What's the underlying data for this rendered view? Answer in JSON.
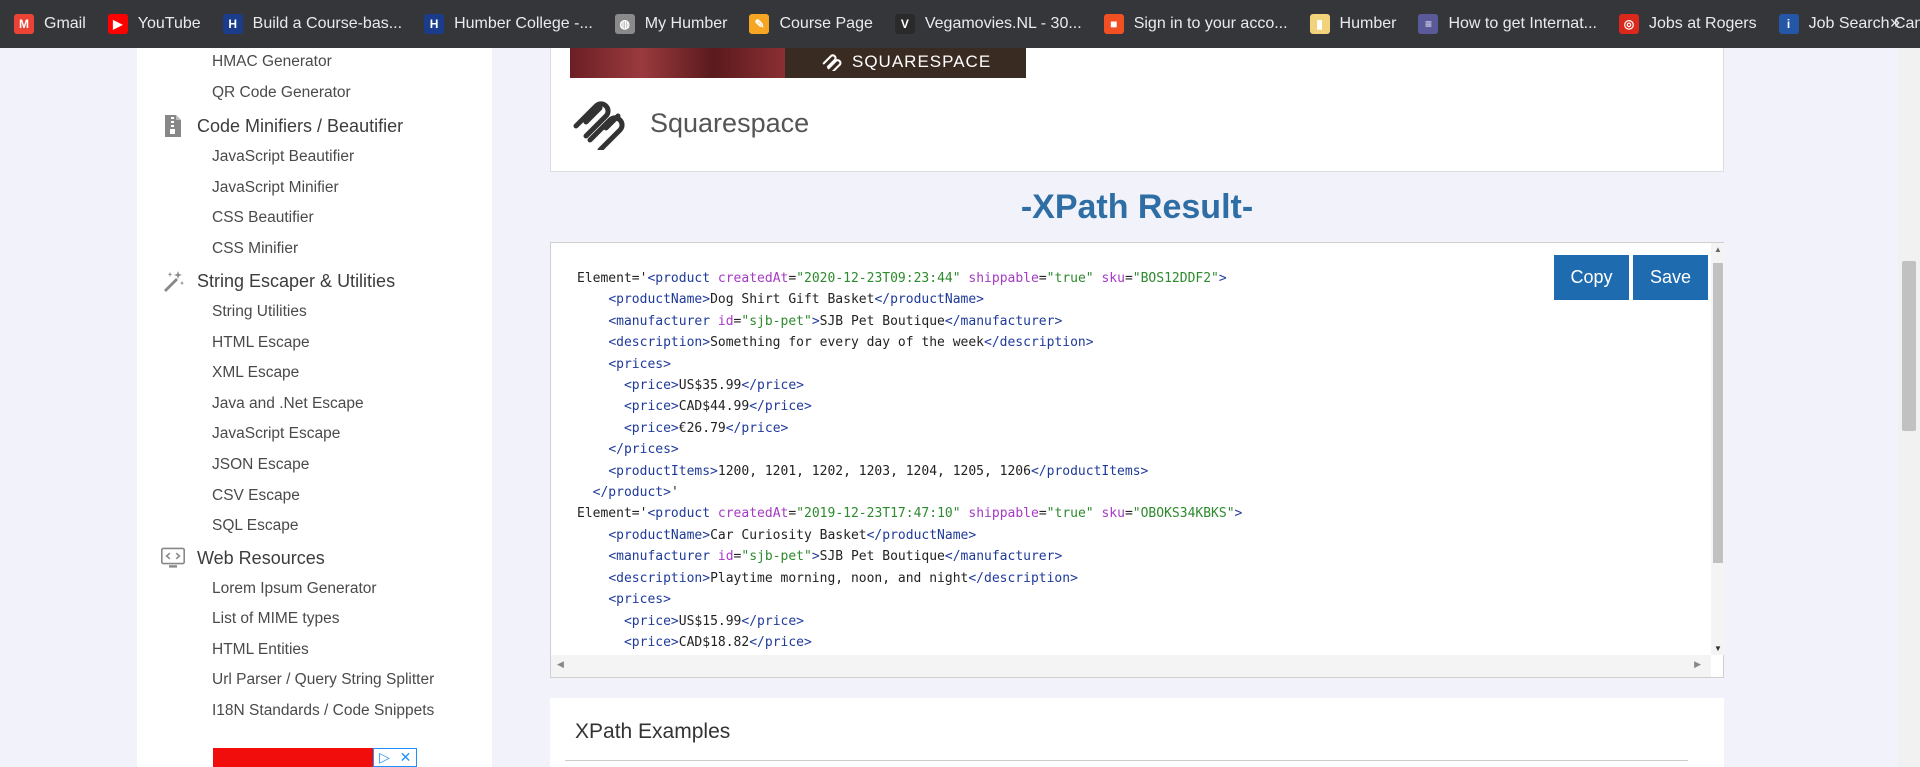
{
  "bookmarks": [
    {
      "label": "Gmail",
      "icon": "gmail-icon",
      "color": "#ea4335"
    },
    {
      "label": "YouTube",
      "icon": "youtube-icon",
      "color": "#ff0000"
    },
    {
      "label": "Build a Course-bas...",
      "icon": "humber-icon",
      "color": "#1a3c8a"
    },
    {
      "label": "Humber College -...",
      "icon": "humber-icon",
      "color": "#1a3c8a"
    },
    {
      "label": "My Humber",
      "icon": "globe-icon",
      "color": "#8a8a8a"
    },
    {
      "label": "Course Page",
      "icon": "pencil-icon",
      "color": "#f6a623"
    },
    {
      "label": "Vegamovies.NL - 30...",
      "icon": "vegamovies-icon",
      "color": "#2a2a2a"
    },
    {
      "label": "Sign in to your acco...",
      "icon": "microsoft-icon",
      "color": "#f25022"
    },
    {
      "label": "Humber",
      "icon": "folder-icon",
      "color": "#f2d27a"
    },
    {
      "label": "How to get Internat...",
      "icon": "article-icon",
      "color": "#5a5a9a"
    },
    {
      "label": "Jobs at Rogers",
      "icon": "rogers-icon",
      "color": "#da291c"
    },
    {
      "label": "Job Search Canada...",
      "icon": "jobsearch-icon",
      "color": "#2557a7"
    }
  ],
  "more_label": "»",
  "sidebar": {
    "top_items": [
      "HMAC Generator",
      "QR Code Generator"
    ],
    "sections": [
      {
        "title": "Code Minifiers / Beautifier",
        "icon": "file-zip-icon",
        "items": [
          "JavaScript Beautifier",
          "JavaScript Minifier",
          "CSS Beautifier",
          "CSS Minifier"
        ]
      },
      {
        "title": "String Escaper & Utilities",
        "icon": "magic-wand-icon",
        "items": [
          "String Utilities",
          "HTML Escape",
          "XML Escape",
          "Java and .Net Escape",
          "JavaScript Escape",
          "JSON Escape",
          "CSV Escape",
          "SQL Escape"
        ]
      },
      {
        "title": "Web Resources",
        "icon": "monitor-code-icon",
        "items": [
          "Lorem Ipsum Generator",
          "List of MIME types",
          "HTML Entities",
          "Url Parser / Query String Splitter",
          "I18N Standards / Code Snippets"
        ]
      }
    ],
    "ad_marks": [
      "▷",
      "✕"
    ]
  },
  "ad": {
    "banner_text": "SQUARESPACE",
    "name": "Squarespace"
  },
  "result_title": "-XPath Result-",
  "buttons": {
    "copy": "Copy",
    "save": "Save"
  },
  "code_lines": [
    [
      [
        "",
        "Element='"
      ],
      [
        "tg",
        "<product"
      ],
      [
        "",
        " "
      ],
      [
        "at",
        "createdAt"
      ],
      [
        "",
        "="
      ],
      [
        "vl",
        "\"2020-12-23T09:23:44\""
      ],
      [
        "",
        " "
      ],
      [
        "at",
        "shippable"
      ],
      [
        "",
        "="
      ],
      [
        "vl",
        "\"true\""
      ],
      [
        "",
        " "
      ],
      [
        "at",
        "sku"
      ],
      [
        "",
        "="
      ],
      [
        "vl",
        "\"BOS12DDF2\""
      ],
      [
        "tg",
        ">"
      ]
    ],
    [
      [
        "",
        "    "
      ],
      [
        "tg",
        "<productName"
      ],
      [
        "tg",
        ">"
      ],
      [
        "",
        "Dog Shirt Gift Basket"
      ],
      [
        "tg",
        "</productName>"
      ]
    ],
    [
      [
        "",
        "    "
      ],
      [
        "tg",
        "<manufacturer"
      ],
      [
        "",
        " "
      ],
      [
        "at",
        "id"
      ],
      [
        "",
        "="
      ],
      [
        "vl",
        "\"sjb-pet\""
      ],
      [
        "tg",
        ">"
      ],
      [
        "",
        "SJB Pet Boutique"
      ],
      [
        "tg",
        "</manufacturer>"
      ]
    ],
    [
      [
        "",
        "    "
      ],
      [
        "tg",
        "<description"
      ],
      [
        "tg",
        ">"
      ],
      [
        "",
        "Something for every day of the week"
      ],
      [
        "tg",
        "</description>"
      ]
    ],
    [
      [
        "",
        "    "
      ],
      [
        "tg",
        "<prices>"
      ]
    ],
    [
      [
        "",
        "      "
      ],
      [
        "tg",
        "<price>"
      ],
      [
        "",
        "US$35.99"
      ],
      [
        "tg",
        "</price>"
      ]
    ],
    [
      [
        "",
        "      "
      ],
      [
        "tg",
        "<price>"
      ],
      [
        "",
        "CAD$44.99"
      ],
      [
        "tg",
        "</price>"
      ]
    ],
    [
      [
        "",
        "      "
      ],
      [
        "tg",
        "<price>"
      ],
      [
        "",
        "€26.79"
      ],
      [
        "tg",
        "</price>"
      ]
    ],
    [
      [
        "",
        "    "
      ],
      [
        "tg",
        "</prices>"
      ]
    ],
    [
      [
        "",
        "    "
      ],
      [
        "tg",
        "<productItems>"
      ],
      [
        "",
        "1200, 1201, 1202, 1203, 1204, 1205, 1206"
      ],
      [
        "tg",
        "</productItems>"
      ]
    ],
    [
      [
        "",
        "  "
      ],
      [
        "tg",
        "</product>"
      ],
      [
        "",
        "'"
      ]
    ],
    [
      [
        "",
        "Element='"
      ],
      [
        "tg",
        "<product"
      ],
      [
        "",
        " "
      ],
      [
        "at",
        "createdAt"
      ],
      [
        "",
        "="
      ],
      [
        "vl",
        "\"2019-12-23T17:47:10\""
      ],
      [
        "",
        " "
      ],
      [
        "at",
        "shippable"
      ],
      [
        "",
        "="
      ],
      [
        "vl",
        "\"true\""
      ],
      [
        "",
        " "
      ],
      [
        "at",
        "sku"
      ],
      [
        "",
        "="
      ],
      [
        "vl",
        "\"OBOKS34KBKS\""
      ],
      [
        "tg",
        ">"
      ]
    ],
    [
      [
        "",
        "    "
      ],
      [
        "tg",
        "<productName"
      ],
      [
        "tg",
        ">"
      ],
      [
        "",
        "Car Curiosity Basket"
      ],
      [
        "tg",
        "</productName>"
      ]
    ],
    [
      [
        "",
        "    "
      ],
      [
        "tg",
        "<manufacturer"
      ],
      [
        "",
        " "
      ],
      [
        "at",
        "id"
      ],
      [
        "",
        "="
      ],
      [
        "vl",
        "\"sjb-pet\""
      ],
      [
        "tg",
        ">"
      ],
      [
        "",
        "SJB Pet Boutique"
      ],
      [
        "tg",
        "</manufacturer>"
      ]
    ],
    [
      [
        "",
        "    "
      ],
      [
        "tg",
        "<description"
      ],
      [
        "tg",
        ">"
      ],
      [
        "",
        "Playtime morning, noon, and night"
      ],
      [
        "tg",
        "</description>"
      ]
    ],
    [
      [
        "",
        "    "
      ],
      [
        "tg",
        "<prices>"
      ]
    ],
    [
      [
        "",
        "      "
      ],
      [
        "tg",
        "<price>"
      ],
      [
        "",
        "US$15.99"
      ],
      [
        "tg",
        "</price>"
      ]
    ],
    [
      [
        "",
        "      "
      ],
      [
        "tg",
        "<price>"
      ],
      [
        "",
        "CAD$18.82"
      ],
      [
        "tg",
        "</price>"
      ]
    ]
  ],
  "examples_title": "XPath Examples",
  "colors": {
    "accent": "#1f6bb0",
    "title_blue": "#2f6ea5",
    "tag": "#1f3a9a",
    "attr": "#a53ac4",
    "value": "#2d8a2d"
  }
}
